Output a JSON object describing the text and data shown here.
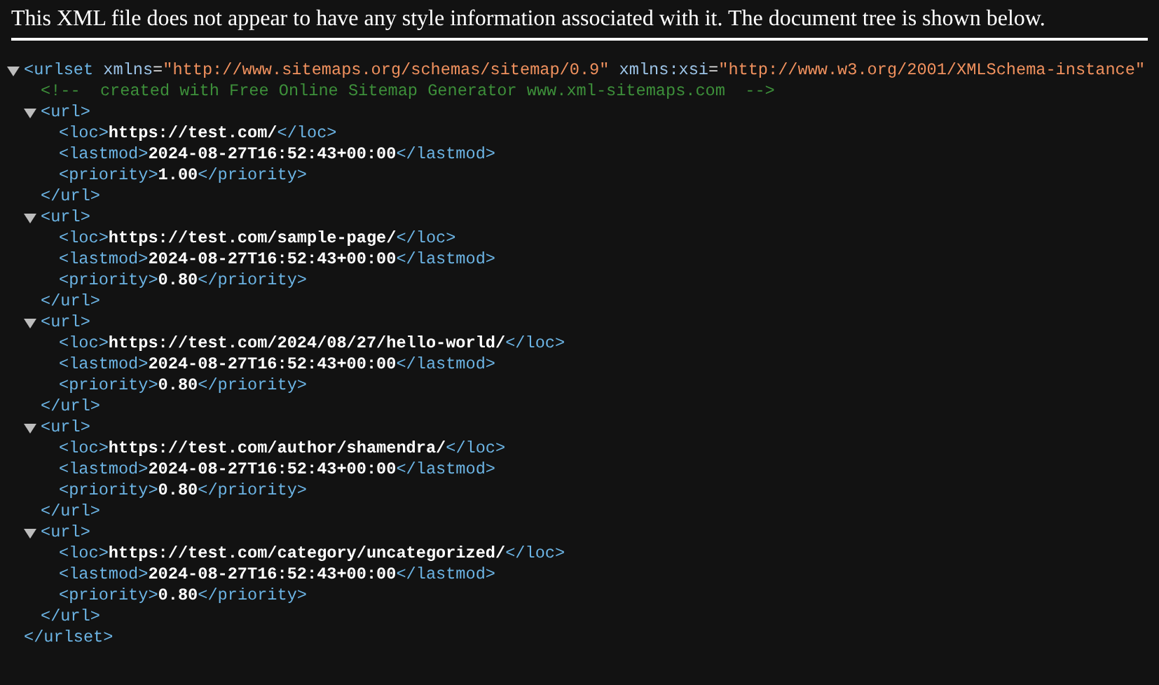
{
  "notice": "This XML file does not appear to have any style information associated with it. The document tree is shown below.",
  "tree": {
    "kind": "element",
    "expanded": true,
    "open": [
      {
        "kind": "tag",
        "text": "<urlset"
      },
      {
        "kind": "attr",
        "text": " xmlns"
      },
      {
        "kind": "punct",
        "text": "="
      },
      {
        "kind": "value",
        "text": "\"http://www.sitemaps.org/schemas/sitemap/0.9\""
      },
      {
        "kind": "attr",
        "text": " xmlns:xsi"
      },
      {
        "kind": "punct",
        "text": "="
      },
      {
        "kind": "value",
        "text": "\"http://www.w3.org/2001/XMLSchema-instance\""
      }
    ],
    "close": "</urlset>",
    "children": [
      {
        "kind": "comment",
        "text": "<!--  created with Free Online Sitemap Generator www.xml-sitemaps.com  -->"
      },
      {
        "kind": "element",
        "expanded": true,
        "open": [
          {
            "kind": "tag",
            "text": "<url>"
          }
        ],
        "close": "</url>",
        "children": [
          {
            "kind": "leaf",
            "tokens": [
              {
                "kind": "tag",
                "text": "<loc>"
              },
              {
                "kind": "text",
                "text": "https://test.com/"
              },
              {
                "kind": "tag",
                "text": "</loc>"
              }
            ]
          },
          {
            "kind": "leaf",
            "tokens": [
              {
                "kind": "tag",
                "text": "<lastmod>"
              },
              {
                "kind": "text",
                "text": "2024-08-27T16:52:43+00:00"
              },
              {
                "kind": "tag",
                "text": "</lastmod>"
              }
            ]
          },
          {
            "kind": "leaf",
            "tokens": [
              {
                "kind": "tag",
                "text": "<priority>"
              },
              {
                "kind": "text",
                "text": "1.00"
              },
              {
                "kind": "tag",
                "text": "</priority>"
              }
            ]
          }
        ]
      },
      {
        "kind": "element",
        "expanded": true,
        "open": [
          {
            "kind": "tag",
            "text": "<url>"
          }
        ],
        "close": "</url>",
        "children": [
          {
            "kind": "leaf",
            "tokens": [
              {
                "kind": "tag",
                "text": "<loc>"
              },
              {
                "kind": "text",
                "text": "https://test.com/sample-page/"
              },
              {
                "kind": "tag",
                "text": "</loc>"
              }
            ]
          },
          {
            "kind": "leaf",
            "tokens": [
              {
                "kind": "tag",
                "text": "<lastmod>"
              },
              {
                "kind": "text",
                "text": "2024-08-27T16:52:43+00:00"
              },
              {
                "kind": "tag",
                "text": "</lastmod>"
              }
            ]
          },
          {
            "kind": "leaf",
            "tokens": [
              {
                "kind": "tag",
                "text": "<priority>"
              },
              {
                "kind": "text",
                "text": "0.80"
              },
              {
                "kind": "tag",
                "text": "</priority>"
              }
            ]
          }
        ]
      },
      {
        "kind": "element",
        "expanded": true,
        "open": [
          {
            "kind": "tag",
            "text": "<url>"
          }
        ],
        "close": "</url>",
        "children": [
          {
            "kind": "leaf",
            "tokens": [
              {
                "kind": "tag",
                "text": "<loc>"
              },
              {
                "kind": "text",
                "text": "https://test.com/2024/08/27/hello-world/"
              },
              {
                "kind": "tag",
                "text": "</loc>"
              }
            ]
          },
          {
            "kind": "leaf",
            "tokens": [
              {
                "kind": "tag",
                "text": "<lastmod>"
              },
              {
                "kind": "text",
                "text": "2024-08-27T16:52:43+00:00"
              },
              {
                "kind": "tag",
                "text": "</lastmod>"
              }
            ]
          },
          {
            "kind": "leaf",
            "tokens": [
              {
                "kind": "tag",
                "text": "<priority>"
              },
              {
                "kind": "text",
                "text": "0.80"
              },
              {
                "kind": "tag",
                "text": "</priority>"
              }
            ]
          }
        ]
      },
      {
        "kind": "element",
        "expanded": true,
        "open": [
          {
            "kind": "tag",
            "text": "<url>"
          }
        ],
        "close": "</url>",
        "children": [
          {
            "kind": "leaf",
            "tokens": [
              {
                "kind": "tag",
                "text": "<loc>"
              },
              {
                "kind": "text",
                "text": "https://test.com/author/shamendra/"
              },
              {
                "kind": "tag",
                "text": "</loc>"
              }
            ]
          },
          {
            "kind": "leaf",
            "tokens": [
              {
                "kind": "tag",
                "text": "<lastmod>"
              },
              {
                "kind": "text",
                "text": "2024-08-27T16:52:43+00:00"
              },
              {
                "kind": "tag",
                "text": "</lastmod>"
              }
            ]
          },
          {
            "kind": "leaf",
            "tokens": [
              {
                "kind": "tag",
                "text": "<priority>"
              },
              {
                "kind": "text",
                "text": "0.80"
              },
              {
                "kind": "tag",
                "text": "</priority>"
              }
            ]
          }
        ]
      },
      {
        "kind": "element",
        "expanded": true,
        "open": [
          {
            "kind": "tag",
            "text": "<url>"
          }
        ],
        "close": "</url>",
        "children": [
          {
            "kind": "leaf",
            "tokens": [
              {
                "kind": "tag",
                "text": "<loc>"
              },
              {
                "kind": "text",
                "text": "https://test.com/category/uncategorized/"
              },
              {
                "kind": "tag",
                "text": "</loc>"
              }
            ]
          },
          {
            "kind": "leaf",
            "tokens": [
              {
                "kind": "tag",
                "text": "<lastmod>"
              },
              {
                "kind": "text",
                "text": "2024-08-27T16:52:43+00:00"
              },
              {
                "kind": "tag",
                "text": "</lastmod>"
              }
            ]
          },
          {
            "kind": "leaf",
            "tokens": [
              {
                "kind": "tag",
                "text": "<priority>"
              },
              {
                "kind": "text",
                "text": "0.80"
              },
              {
                "kind": "tag",
                "text": "</priority>"
              }
            ]
          }
        ]
      }
    ]
  }
}
